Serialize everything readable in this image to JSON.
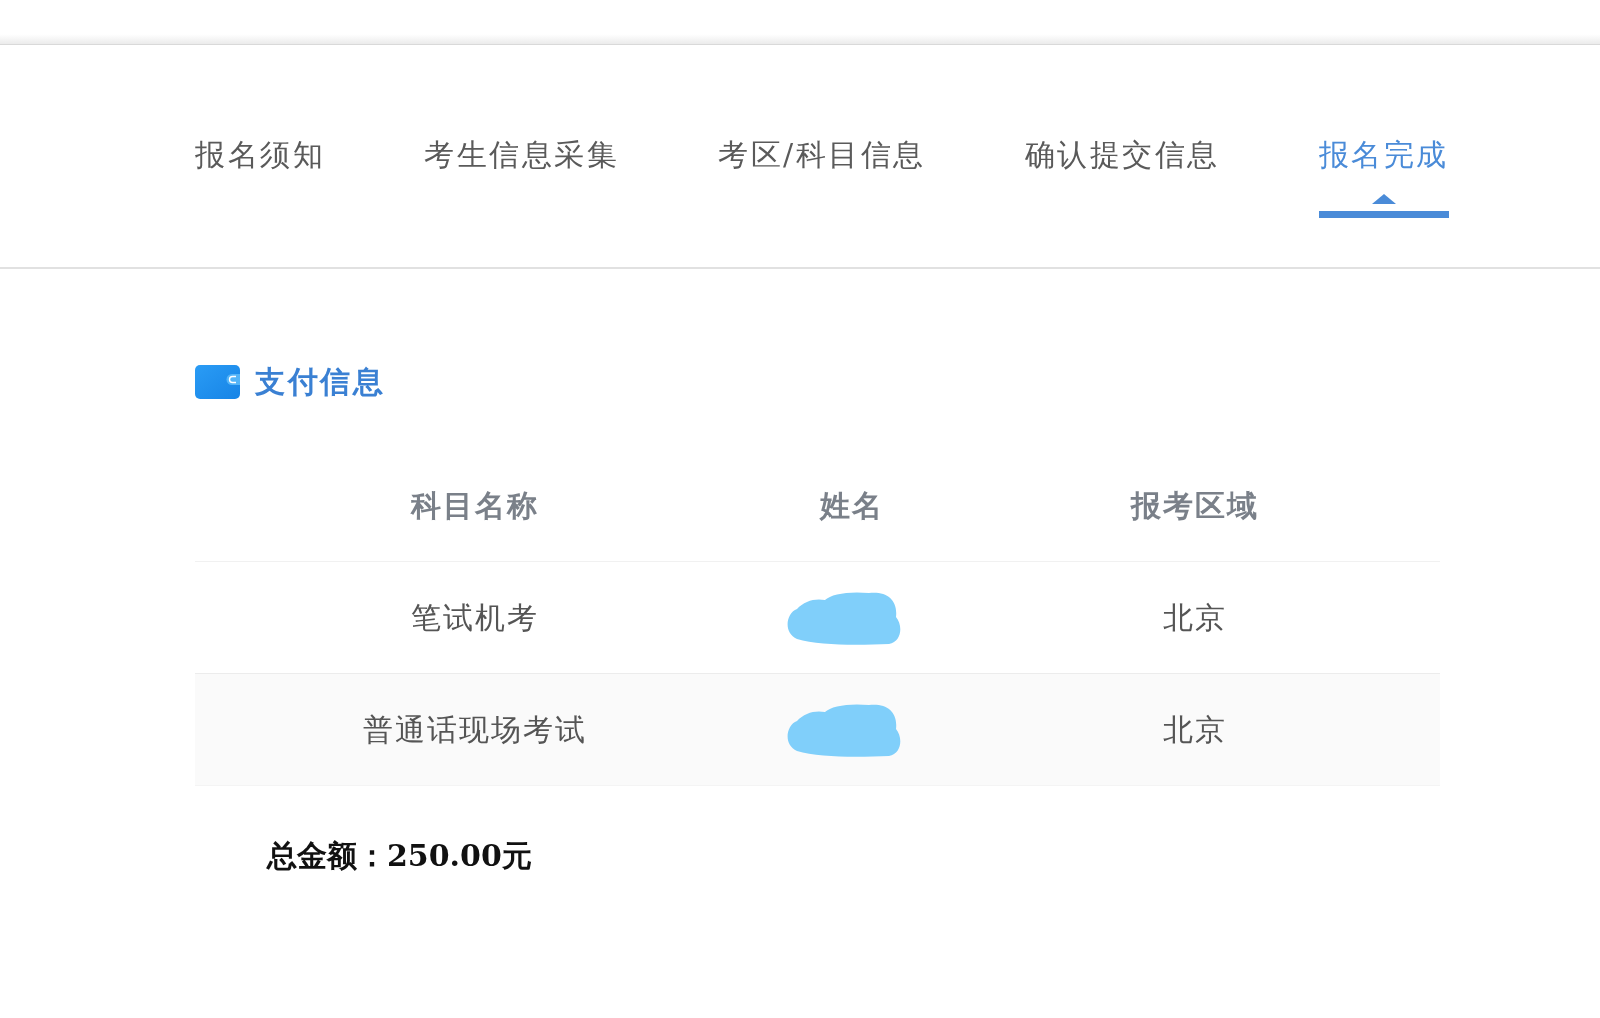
{
  "steps": [
    {
      "label": "报名须知",
      "selected": false
    },
    {
      "label": "考生信息采集",
      "selected": false
    },
    {
      "label": "考区/科目信息",
      "selected": false
    },
    {
      "label": "确认提交信息",
      "selected": false
    },
    {
      "label": "报名完成",
      "selected": true
    }
  ],
  "payment": {
    "title": "支付信息",
    "table": {
      "columns": [
        "科目名称",
        "姓名",
        "报考区域"
      ],
      "rows": [
        {
          "subject": "笔试机考",
          "name_redacted": true,
          "region": "北京"
        },
        {
          "subject": "普通话现场考试",
          "name_redacted": true,
          "region": "北京"
        }
      ]
    },
    "total": "总金额：250.00元"
  }
}
